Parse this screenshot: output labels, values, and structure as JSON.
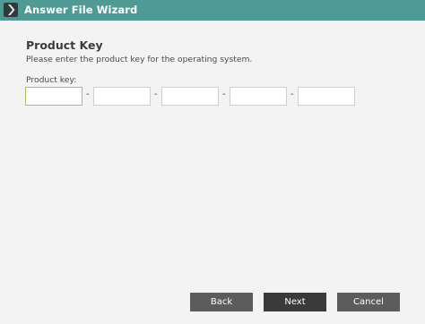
{
  "window": {
    "title": "Answer File Wizard",
    "icon": "wizard-chevron-icon",
    "colors": {
      "titlebar": "#4f9a94",
      "background": "#f3f3f3",
      "button": "#5c5c5c",
      "button_primary": "#3a3a3a",
      "focus_border": "#a7c25f"
    }
  },
  "page": {
    "heading": "Product Key",
    "description": "Please enter the product key for the operating system."
  },
  "product_key": {
    "label": "Product key:",
    "separator": "-",
    "segments": [
      "",
      "",
      "",
      "",
      ""
    ]
  },
  "buttons": {
    "back": "Back",
    "next": "Next",
    "cancel": "Cancel"
  }
}
